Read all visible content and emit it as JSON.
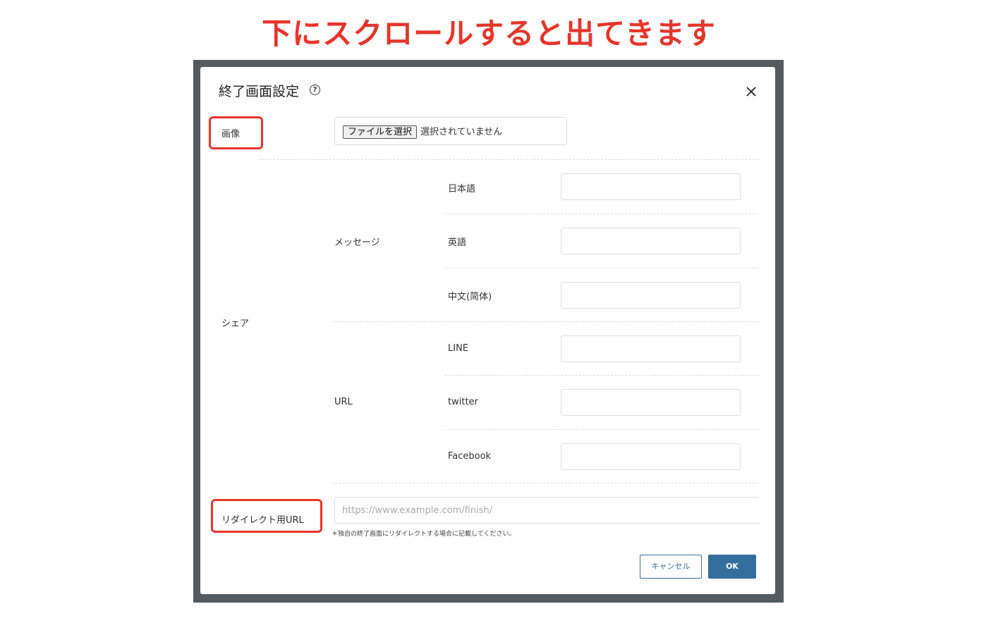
{
  "headline": "下にスクロールすると出てきます",
  "modal": {
    "title": "終了画面設定",
    "help_glyph": "?",
    "image_label": "画像",
    "file_button": "ファイルを選択",
    "file_status": "選択されていません",
    "share_label": "シェア",
    "message_label": "メッセージ",
    "lang_ja": "日本語",
    "lang_en": "英語",
    "lang_zh": "中文(简体)",
    "url_label": "URL",
    "sns_line": "LINE",
    "sns_twitter": "twitter",
    "sns_facebook": "Facebook",
    "redirect_label": "リダイレクト用URL",
    "redirect_placeholder": "https://www.example.com/finish/",
    "redirect_note": "＊独自の終了画面にリダイレクトする場合に記載してください。",
    "cancel_label": "キャンセル",
    "ok_label": "OK"
  },
  "colors": {
    "highlight": "#e8352b",
    "primary": "#346e9c",
    "backdrop": "#555a5f"
  }
}
